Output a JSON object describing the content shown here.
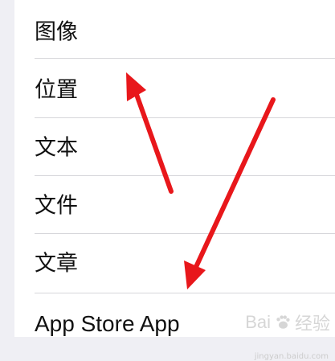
{
  "settings_list": {
    "items": [
      {
        "label": "图像"
      },
      {
        "label": "位置"
      },
      {
        "label": "文本"
      },
      {
        "label": "文件"
      },
      {
        "label": "文章"
      },
      {
        "label": "App Store App"
      }
    ]
  },
  "watermark": {
    "brand": "Bai",
    "brand_suffix": "经验",
    "sub": "jingyan.baidu.com"
  },
  "annotation": {
    "arrow_color": "#e8171b"
  }
}
